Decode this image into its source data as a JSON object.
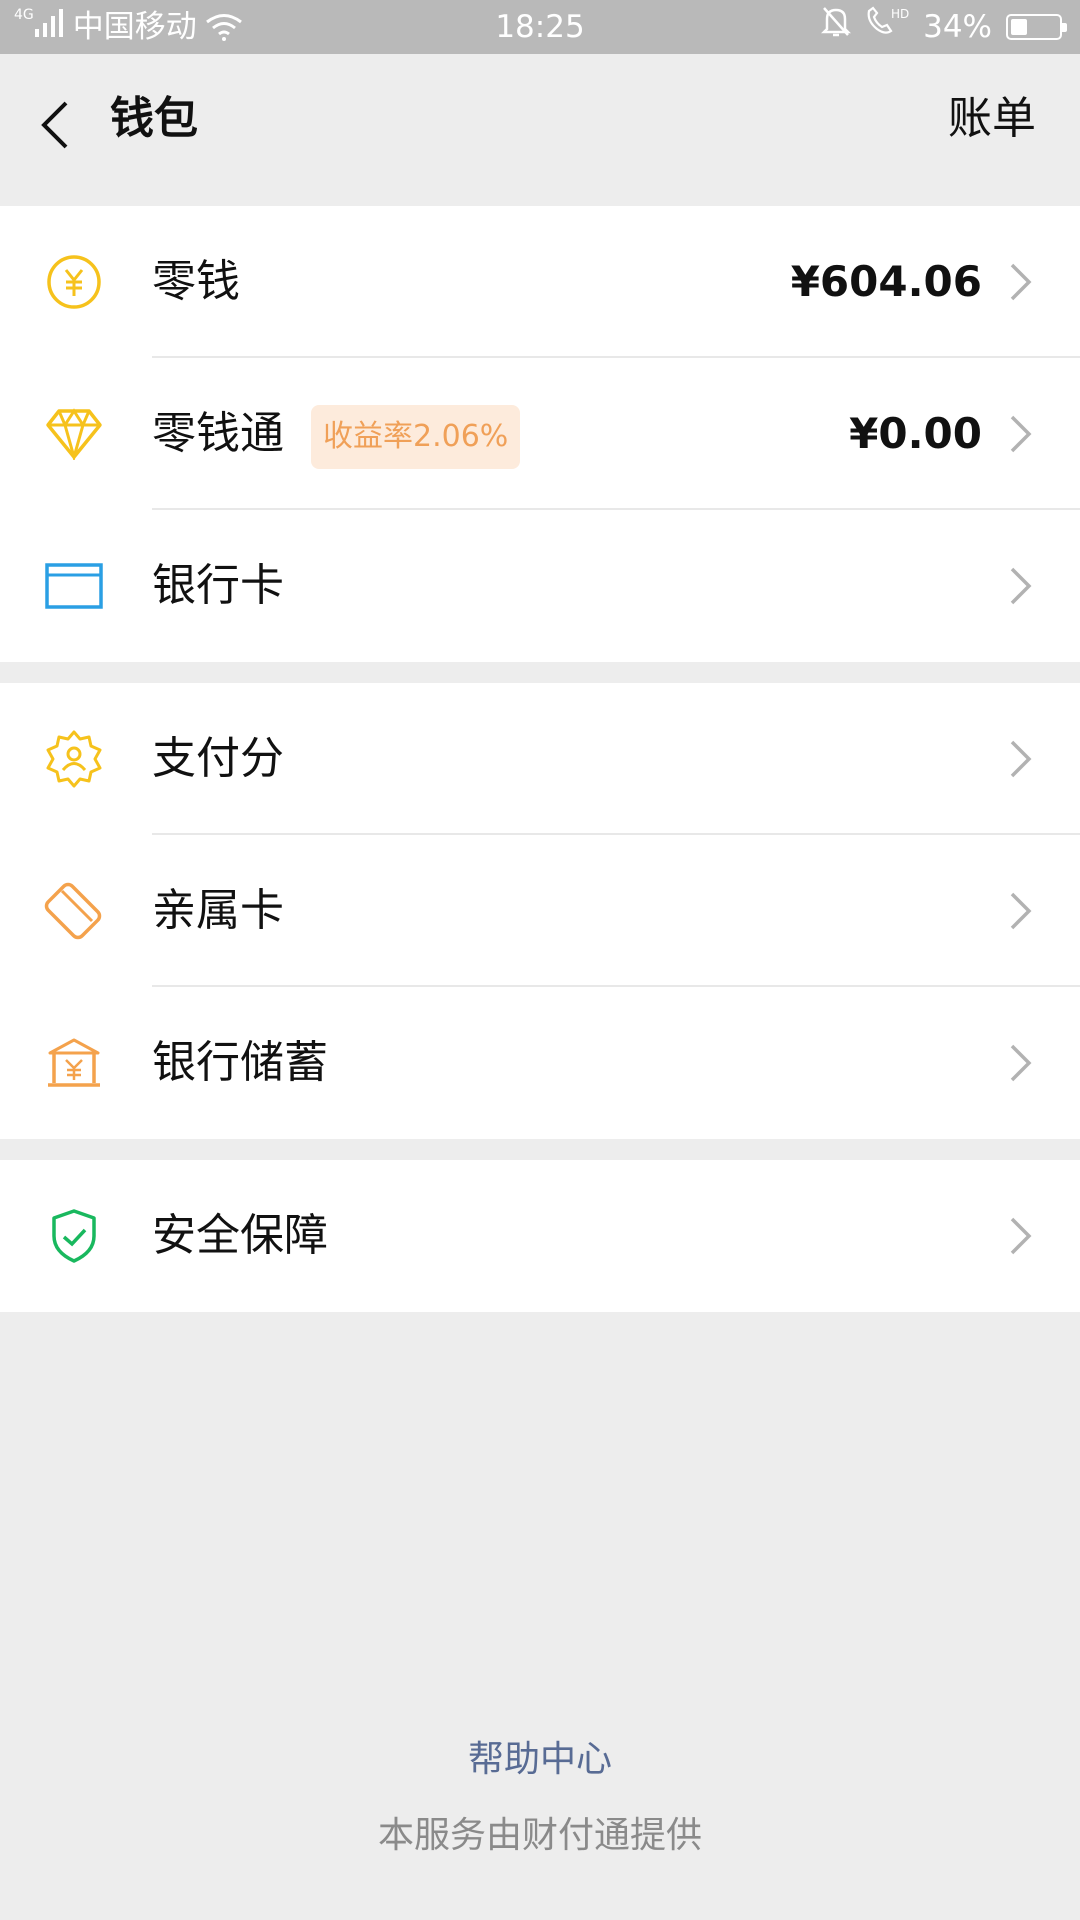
{
  "status_bar": {
    "network": "4G",
    "carrier": "中国移动",
    "time": "18:25",
    "battery": "34%",
    "battery_level": 0.34
  },
  "nav": {
    "title": "钱包",
    "action": "账单"
  },
  "groups": [
    {
      "rows": [
        {
          "label": "零钱",
          "icon": "yuan-coin-icon",
          "value": "¥604.06"
        },
        {
          "label": "零钱通",
          "icon": "diamond-icon",
          "badge": "收益率2.06%",
          "value": "¥0.00"
        },
        {
          "label": "银行卡",
          "icon": "bank-card-icon"
        }
      ]
    },
    {
      "rows": [
        {
          "label": "支付分",
          "icon": "payment-score-icon"
        },
        {
          "label": "亲属卡",
          "icon": "family-card-icon"
        },
        {
          "label": "银行储蓄",
          "icon": "bank-savings-icon"
        }
      ]
    },
    {
      "rows": [
        {
          "label": "安全保障",
          "icon": "security-shield-icon"
        }
      ]
    }
  ],
  "footer": {
    "help": "帮助中心",
    "note": "本服务由财付通提供"
  },
  "colors": {
    "yuan": "#f6c21c",
    "diamond": "#f6c21c",
    "bank_card": "#2a9fe4",
    "payment_score": "#f6c21c",
    "family_card": "#f4a24c",
    "savings": "#f4a24c",
    "security": "#19b85e",
    "badge_bg": "#fdebdc",
    "badge_text": "#f0a058",
    "link": "#586b94"
  }
}
